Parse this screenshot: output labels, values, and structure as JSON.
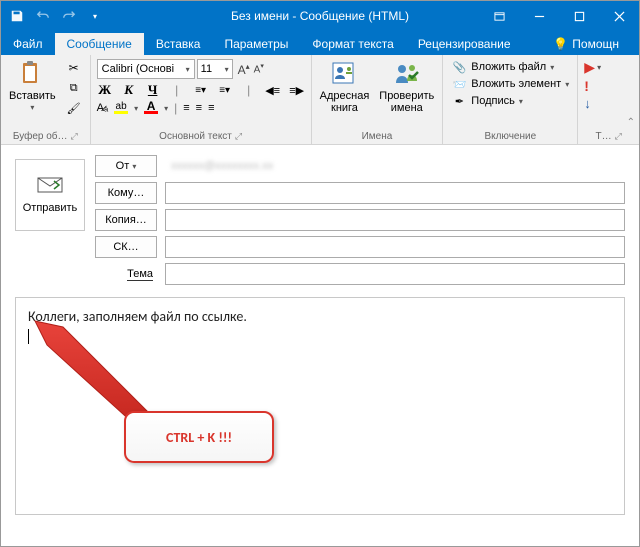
{
  "window": {
    "title": "Без имени - Сообщение (HTML)"
  },
  "tabs": {
    "file": "Файл",
    "message": "Сообщение",
    "insert": "Вставка",
    "options": "Параметры",
    "format": "Формат текста",
    "review": "Рецензирование",
    "tell": "Помощн"
  },
  "ribbon": {
    "clipboard": {
      "paste": "Вставить",
      "label": "Буфер об…"
    },
    "font": {
      "name": "Calibri (Основі",
      "size": "11",
      "label": "Основной текст"
    },
    "names": {
      "addressbook": "Адресная\nкнига",
      "checknames": "Проверить\nимена",
      "label": "Имена"
    },
    "include": {
      "attachfile": "Вложить файл",
      "attachitem": "Вложить элемент",
      "signature": "Подпись",
      "label": "Включение"
    },
    "tags": {
      "label": "Т…"
    }
  },
  "compose": {
    "send": "Отправить",
    "from_btn": "От",
    "from_value": "xxxxxx@xxxxxxxx.xx",
    "to_btn": "Кому…",
    "cc_btn": "Копия…",
    "bcc_btn": "СК…",
    "subject_label": "Тема"
  },
  "body": {
    "text": "Коллеги, заполняем файл по ссылке."
  },
  "callout": {
    "text": "CTRL + K !!!"
  }
}
